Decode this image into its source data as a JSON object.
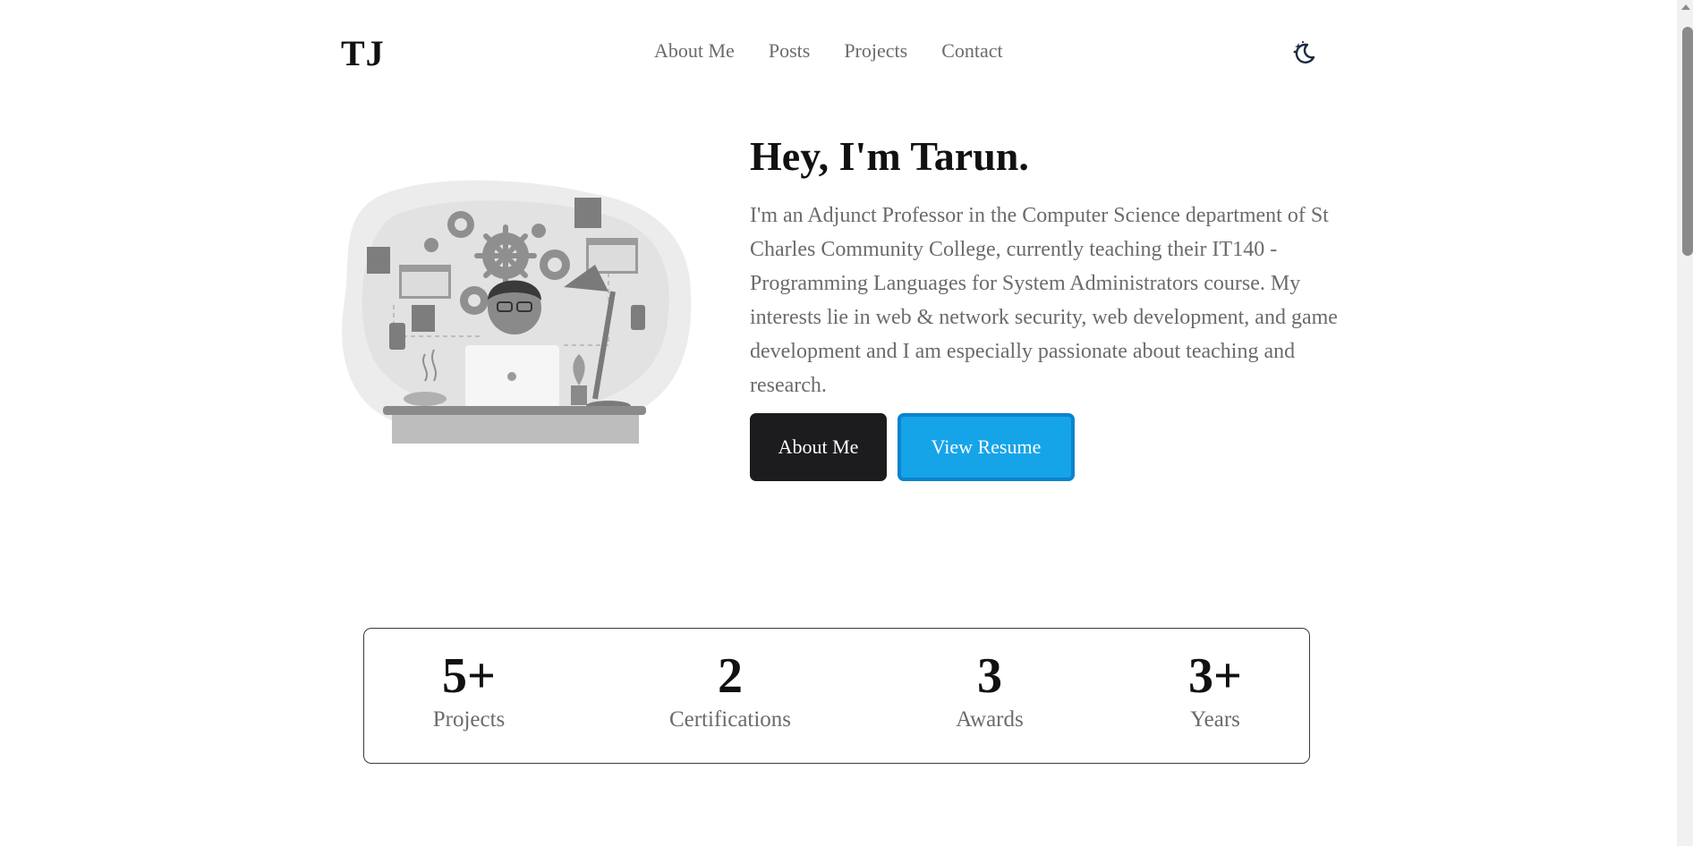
{
  "header": {
    "logo": "TJ",
    "nav": [
      {
        "label": "About Me"
      },
      {
        "label": "Posts"
      },
      {
        "label": "Projects"
      },
      {
        "label": "Contact"
      }
    ],
    "theme_icon": "moon-stars-icon"
  },
  "hero": {
    "title": "Hey, I'm Tarun.",
    "intro": "I'm an Adjunct Professor in the Computer Science department of St Charles Community College, currently teaching their IT140 - Programming Languages for System Administrators course. My interests lie in web & network security, web development, and game development and I am especially passionate about teaching and research.",
    "illustration_icon": "developer-at-desk-illustration",
    "buttons": {
      "about_label": "About Me",
      "resume_label": "View Resume"
    }
  },
  "stats": [
    {
      "value": "5+",
      "label": "Projects"
    },
    {
      "value": "2",
      "label": "Certifications"
    },
    {
      "value": "3",
      "label": "Awards"
    },
    {
      "value": "3+",
      "label": "Years"
    }
  ],
  "colors": {
    "text": "#111111",
    "muted": "#6b6b6b",
    "dark_button": "#1c1c1f",
    "accent": "#16a4e9",
    "accent_border": "#0b83cc"
  }
}
